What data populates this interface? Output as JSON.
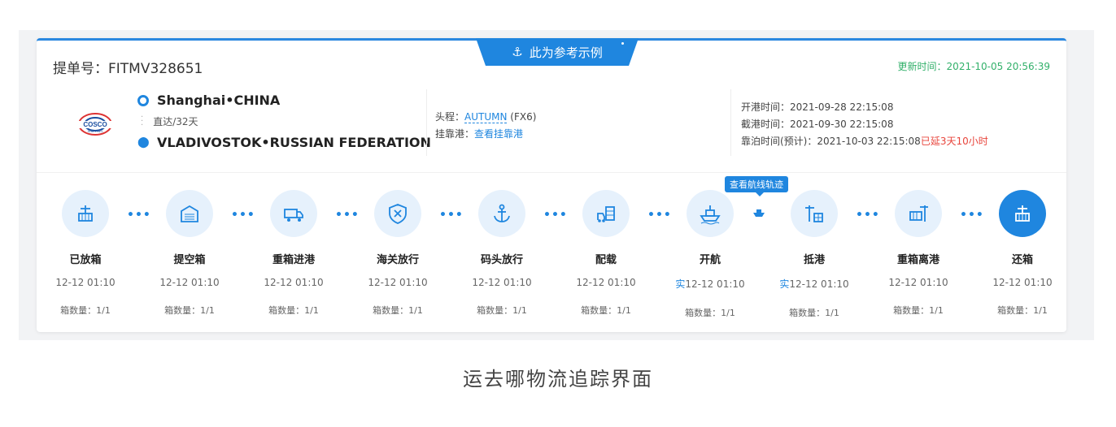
{
  "banner": {
    "label": "此为参考示例"
  },
  "header": {
    "bl_label": "提单号：FITMV328651",
    "updated": "更新时间：2021-10-05 20:56:39"
  },
  "logo": {
    "name": "COSCO SHIPPING"
  },
  "route": {
    "origin": "Shanghai•CHINA",
    "transit": "直达/32天",
    "destination": "VLADIVOSTOK•RUSSIAN FEDERATION"
  },
  "voyage": {
    "first_leg_label": "头程：",
    "first_leg_value": "AUTUMN",
    "first_leg_code": "(FX6)",
    "port_label": "挂靠港：",
    "port_link": "查看挂靠港"
  },
  "times": {
    "open": "开港时间：2021-09-28 22:15:08",
    "cutoff": "截港时间：2021-09-30 22:15:08",
    "berth": "靠泊时间(预计)：2021-10-03 22:15:08",
    "delay": "已延3天10小时"
  },
  "tooltip": {
    "label": "查看航线轨迹"
  },
  "steps": [
    {
      "label": "已放箱",
      "time": "12-12 01:10",
      "real": "",
      "count": "箱数量：1/1",
      "icon": "container-crane-icon",
      "active": false
    },
    {
      "label": "提空箱",
      "time": "12-12 01:10",
      "real": "",
      "count": "箱数量：1/1",
      "icon": "warehouse-icon",
      "active": false
    },
    {
      "label": "重箱进港",
      "time": "12-12 01:10",
      "real": "",
      "count": "箱数量：1/1",
      "icon": "truck-icon",
      "active": false
    },
    {
      "label": "海关放行",
      "time": "12-12 01:10",
      "real": "",
      "count": "箱数量：1/1",
      "icon": "customs-shield-icon",
      "active": false
    },
    {
      "label": "码头放行",
      "time": "12-12 01:10",
      "real": "",
      "count": "箱数量：1/1",
      "icon": "anchor-icon",
      "active": false
    },
    {
      "label": "配载",
      "time": "12-12 01:10",
      "real": "",
      "count": "箱数量：1/1",
      "icon": "loading-icon",
      "active": false
    },
    {
      "label": "开航",
      "time": "12-12 01:10",
      "real": "实",
      "count": "箱数量：1/1",
      "icon": "ship-icon",
      "active": false
    },
    {
      "label": "抵港",
      "time": "12-12 01:10",
      "real": "实",
      "count": "箱数量：1/1",
      "icon": "port-crane-icon",
      "active": false
    },
    {
      "label": "重箱离港",
      "time": "12-12 01:10",
      "real": "",
      "count": "箱数量：1/1",
      "icon": "container-departure-icon",
      "active": false
    },
    {
      "label": "还箱",
      "time": "12-12 01:10",
      "real": "",
      "count": "箱数量：1/1",
      "icon": "container-return-icon",
      "active": true
    }
  ],
  "caption": "运去哪物流追踪界面",
  "colors": {
    "accent": "#1f86df",
    "updated": "#32b06a",
    "delay": "#e8453c",
    "step_bg": "#e6f1fc"
  }
}
